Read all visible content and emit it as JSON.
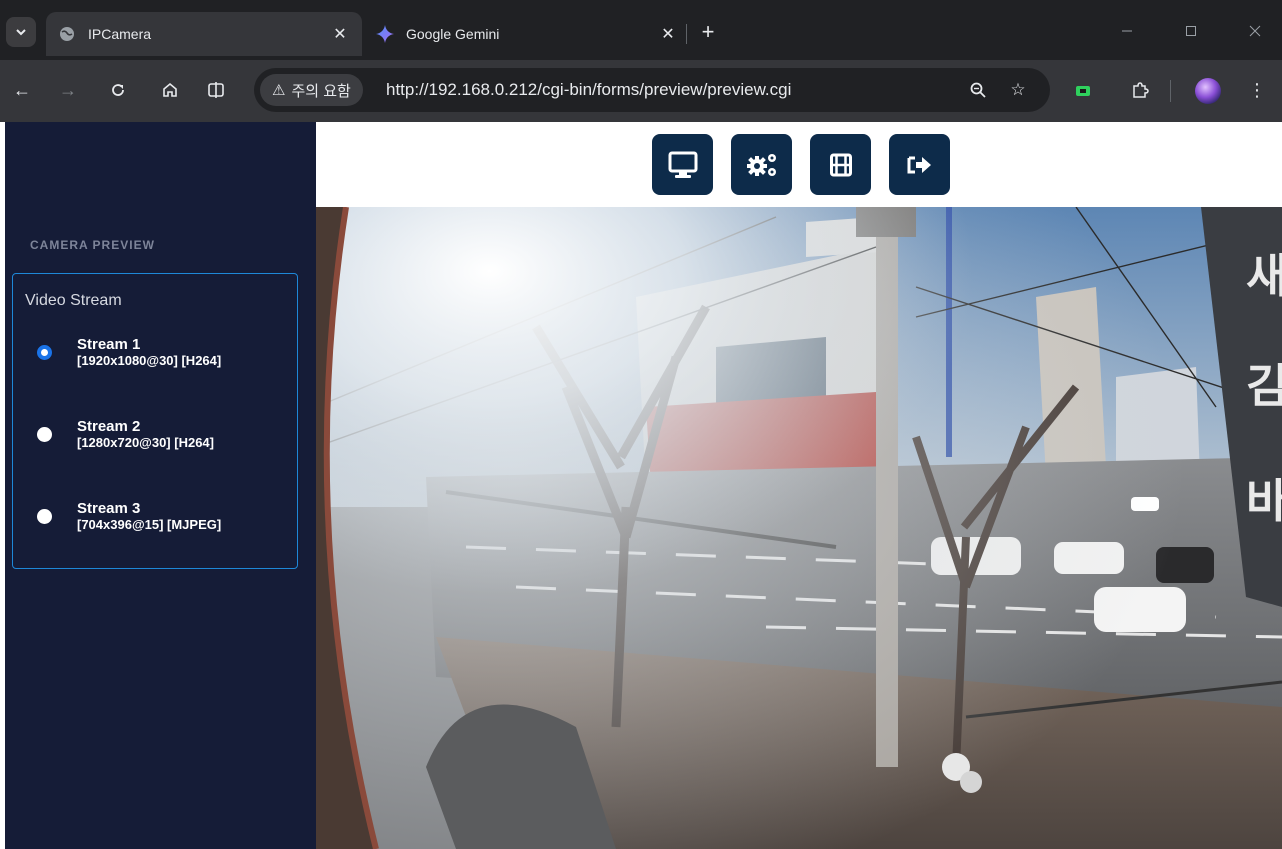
{
  "browser": {
    "tabs": [
      {
        "title": "IPCamera",
        "active": true
      },
      {
        "title": "Google Gemini",
        "active": false
      }
    ],
    "security_chip": "주의 요함",
    "url": "http://192.168.0.212/cgi-bin/forms/preview/preview.cgi"
  },
  "sidebar": {
    "section_label": "CAMERA PREVIEW",
    "group_title": "Video Stream",
    "streams": [
      {
        "name": "Stream 1",
        "spec": "[1920x1080@30] [H264]",
        "selected": true
      },
      {
        "name": "Stream 2",
        "spec": "[1280x720@30] [H264]",
        "selected": false
      },
      {
        "name": "Stream 3",
        "spec": "[704x396@15] [MJPEG]",
        "selected": false
      }
    ]
  },
  "toolbar_buttons": [
    {
      "icon": "monitor-icon"
    },
    {
      "icon": "gears-icon"
    },
    {
      "icon": "film-icon"
    },
    {
      "icon": "sign-out-icon"
    }
  ],
  "colors": {
    "sidebar_bg": "#151c37",
    "accent_blue": "#1a73e8",
    "button_navy": "#0d2b4a",
    "stream_box_border": "#1e88d8"
  }
}
